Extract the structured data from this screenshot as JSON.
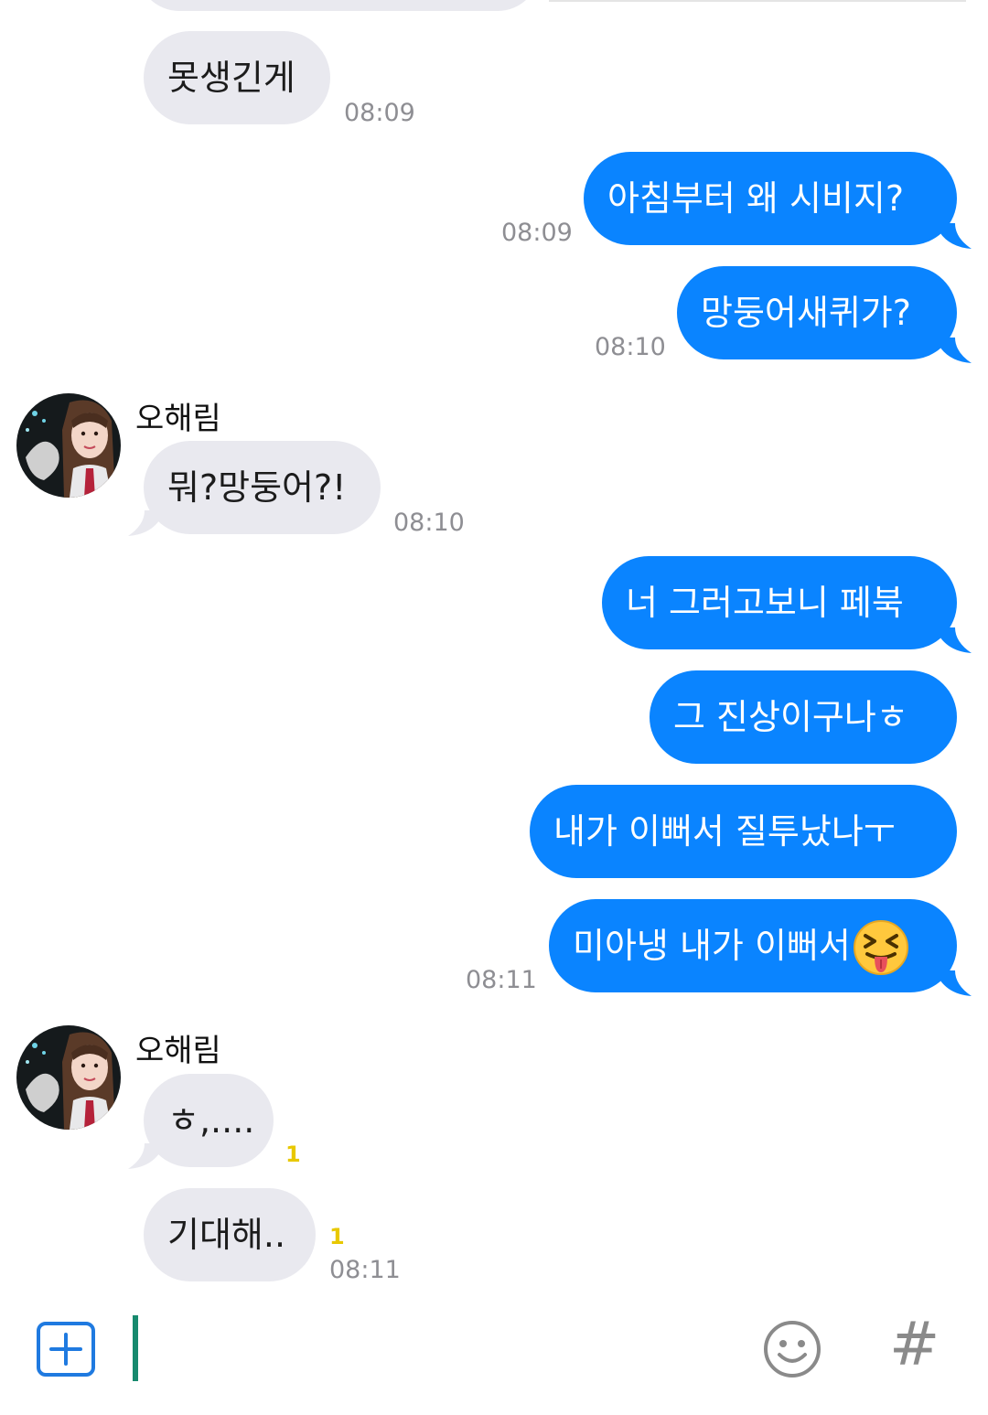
{
  "conversation": {
    "contact_name": "오해림",
    "messages": [
      {
        "id": "m1",
        "direction": "incoming",
        "text": "못생긴게",
        "time": "08:09"
      },
      {
        "id": "m2",
        "direction": "outgoing",
        "text": "아침부터 왜 시비지?",
        "time": "08:09"
      },
      {
        "id": "m3",
        "direction": "outgoing",
        "text": "망둥어새퀴가?",
        "time": "08:10"
      },
      {
        "id": "m4",
        "direction": "incoming",
        "sender": "오해림",
        "text": "뭐?망둥어?!",
        "time": "08:10"
      },
      {
        "id": "m5",
        "direction": "outgoing",
        "text": "너 그러고보니 페북",
        "time": ""
      },
      {
        "id": "m6",
        "direction": "outgoing",
        "text": "그 진상이구나ㅎ",
        "time": ""
      },
      {
        "id": "m7",
        "direction": "outgoing",
        "text": "내가 이뻐서 질투났나ㅜ",
        "time": ""
      },
      {
        "id": "m8",
        "direction": "outgoing",
        "text": "미아냉 내가 이뻐서",
        "emoji": "squinting-face-with-tongue",
        "time": "08:11"
      },
      {
        "id": "m9",
        "direction": "incoming",
        "sender": "오해림",
        "text": "ㅎ,....",
        "unread": "1",
        "time": ""
      },
      {
        "id": "m10",
        "direction": "incoming",
        "text": "기대해..",
        "unread": "1",
        "time": "08:11"
      }
    ]
  },
  "input_bar": {
    "plus_icon": "plus-square-icon",
    "emoji_icon": "smiley-icon",
    "hashtag_label": "#",
    "placeholder": ""
  },
  "colors": {
    "outgoing_bubble": "#0a84ff",
    "incoming_bubble": "#e9e9ef",
    "timestamp": "#8e8e93",
    "unread_badge": "#e8c800",
    "caret": "#178a6e",
    "plus_button": "#1f7ae0"
  }
}
